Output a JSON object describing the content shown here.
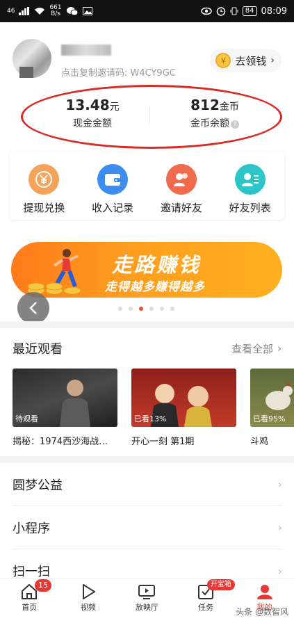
{
  "status_bar": {
    "network": "46",
    "speed_value": "661",
    "speed_unit": "B/s",
    "battery": "84",
    "time": "08:09"
  },
  "profile": {
    "invite_text": "点击复制邀请码: W4CY9GC",
    "get_money": "去领钱"
  },
  "balances": {
    "cash_value": "13.48",
    "cash_unit": "元",
    "cash_label": "现金金额",
    "coin_value": "812",
    "coin_unit": "金币",
    "coin_label": "金币余额",
    "help_glyph": "?"
  },
  "quick_actions": [
    {
      "label": "提现兑换",
      "icon": "yen-icon",
      "color": "#f5a35a"
    },
    {
      "label": "收入记录",
      "icon": "wallet-icon",
      "color": "#3b8ef0"
    },
    {
      "label": "邀请好友",
      "icon": "invite-user-icon",
      "color": "#f06a4d"
    },
    {
      "label": "好友列表",
      "icon": "friend-list-icon",
      "color": "#2cc6c9"
    }
  ],
  "banner": {
    "title": "走路赚钱",
    "subtitle": "走得越多赚得越多",
    "slides": 6,
    "active_slide": 3
  },
  "recent": {
    "title": "最近观看",
    "view_all": "查看全部",
    "items": [
      {
        "progress": "待观看",
        "title": "揭秘：1974西沙海战…"
      },
      {
        "progress": "已看13%",
        "title": "开心一刻 第1期"
      },
      {
        "progress": "已看95%",
        "title": "斗鸡"
      }
    ]
  },
  "menu": [
    {
      "label": "圆梦公益"
    },
    {
      "label": "小程序"
    },
    {
      "label": "扫一扫"
    }
  ],
  "tabbar": [
    {
      "label": "首页",
      "icon": "home-icon",
      "badge": "15"
    },
    {
      "label": "视频",
      "icon": "play-icon",
      "badge": ""
    },
    {
      "label": "放映厅",
      "icon": "tv-icon",
      "badge": ""
    },
    {
      "label": "任务",
      "icon": "task-icon",
      "badge": "开宝箱"
    },
    {
      "label": "我的",
      "icon": "profile-icon",
      "badge": ""
    }
  ],
  "watermark": "头条 @数智风",
  "colors": {
    "accent_red": "#e53935",
    "circle_red": "#d92a24",
    "banner_orange": "#ff9c1e"
  }
}
